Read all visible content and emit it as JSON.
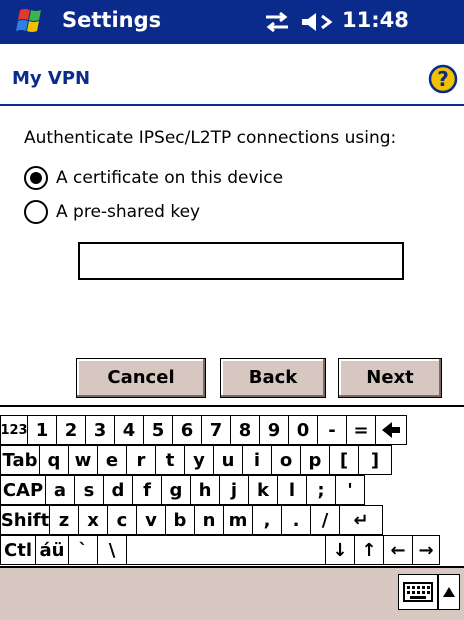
{
  "titlebar": {
    "title": "Settings",
    "clock": "11:48",
    "icons": [
      "windows-start-icon",
      "connectivity-icon",
      "volume-icon"
    ]
  },
  "header": {
    "title": "My VPN",
    "help_icon": "help-icon"
  },
  "auth": {
    "prompt": "Authenticate IPSec/L2TP connections using:",
    "options": [
      {
        "label": "A certificate on this device",
        "selected": true
      },
      {
        "label": "A pre-shared key",
        "selected": false
      }
    ],
    "key_value": ""
  },
  "buttons": {
    "cancel": "Cancel",
    "back": "Back",
    "next": "Next"
  },
  "keyboard": {
    "rows": [
      [
        "123",
        "1",
        "2",
        "3",
        "4",
        "5",
        "6",
        "7",
        "8",
        "9",
        "0",
        "-",
        "=",
        "◆"
      ],
      [
        "Tab",
        "q",
        "w",
        "e",
        "r",
        "t",
        "y",
        "u",
        "i",
        "o",
        "p",
        "[",
        "]"
      ],
      [
        "CAP",
        "a",
        "s",
        "d",
        "f",
        "g",
        "h",
        "j",
        "k",
        "l",
        ";",
        "'"
      ],
      [
        "Shift",
        "z",
        "x",
        "c",
        "v",
        "b",
        "n",
        "m",
        ",",
        ".",
        "/",
        "↵"
      ],
      [
        "Ctl",
        "áü",
        "`",
        "\\",
        "",
        "↓",
        "↑",
        "←",
        "→"
      ]
    ]
  },
  "bottombar": {
    "input_icon": "keyboard-icon",
    "menu_icon": "arrow-up-icon"
  },
  "colors": {
    "titlebar": "#0a2a8c",
    "accent": "#0a2a8c",
    "button_face": "#d6c8c0"
  }
}
